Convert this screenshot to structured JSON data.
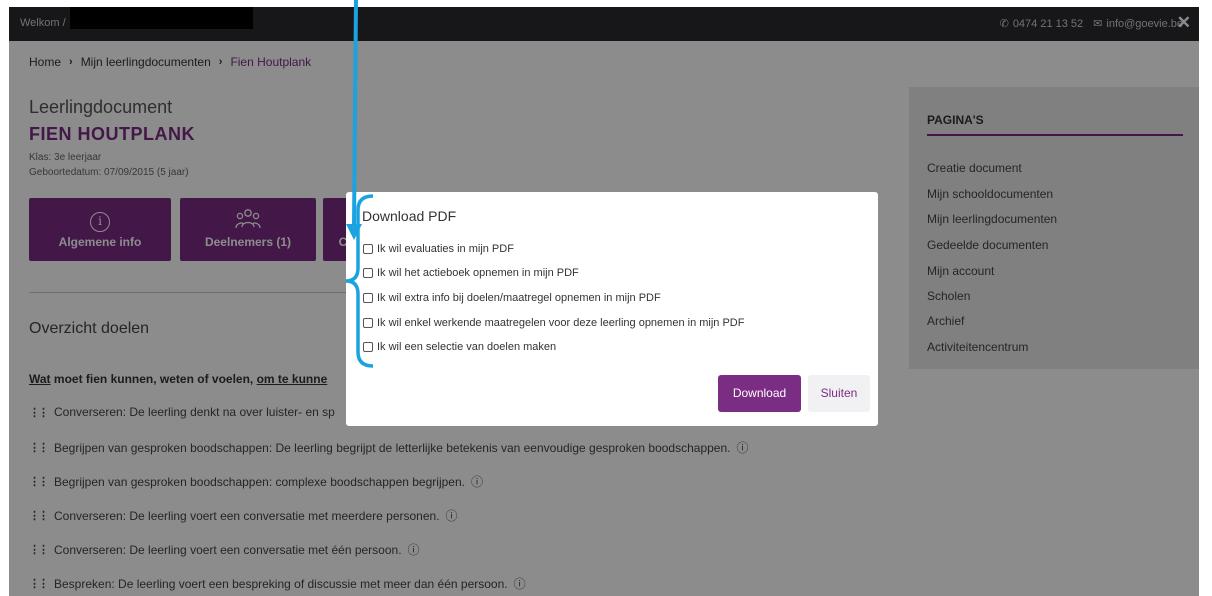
{
  "topbar": {
    "welcome": "Welkom /",
    "phone": "0474 21 13 52",
    "email": "info@goevie.be",
    "phone_icon": "phone-icon",
    "email_icon": "mail-icon",
    "close_glyph": "✕"
  },
  "breadcrumb": {
    "items": [
      "Home",
      "Mijn leerlingdocumenten",
      "Fien Houtplank"
    ],
    "separator": "›"
  },
  "header": {
    "title": "Leerlingdocument",
    "student_name": "FIEN HOUTPLANK",
    "class": "Klas: 3e leerjaar",
    "birthdate": "Geboortedatum: 07/09/2015 (5 jaar)"
  },
  "tiles": [
    {
      "label": "Algemene info",
      "icon": "info-icon"
    },
    {
      "label": "Deelnemers (1)",
      "icon": "people-icon"
    },
    {
      "label": "C",
      "icon": ""
    }
  ],
  "overview": {
    "title": "Overzicht doelen",
    "question_w1": "Wat",
    "question_mid": " moet fien kunnen, weten of voelen, ",
    "question_w2": "om te kunne"
  },
  "goals": [
    "Converseren: De leerling denkt na over luister- en sp",
    "Begrijpen van gesproken boodschappen: De leerling begrijpt de letterlijke betekenis van eenvoudige gesproken boodschappen.",
    "Begrijpen van gesproken boodschappen: complexe boodschappen begrijpen.",
    "Converseren: De leerling voert een conversatie met meerdere personen.",
    "Converseren: De leerling voert een conversatie met één persoon.",
    "Bespreken: De leerling voert een bespreking of discussie met meer dan één persoon."
  ],
  "sidebar": {
    "title": "PAGINA'S",
    "items": [
      "Creatie document",
      "Mijn schooldocumenten",
      "Mijn leerlingdocumenten",
      "Gedeelde documenten",
      "Mijn account",
      "Scholen",
      "Archief",
      "Activiteitencentrum"
    ]
  },
  "modal": {
    "title": "Download PDF",
    "options": [
      "Ik wil evaluaties in mijn PDF",
      "Ik wil het actieboek opnemen in mijn PDF",
      "Ik wil extra info bij doelen/maatregel opnemen in mijn PDF",
      "Ik wil enkel werkende maatregelen voor deze leerling opnemen in mijn PDF",
      "Ik wil een selectie van doelen maken"
    ],
    "download_label": "Download",
    "close_label": "Sluiten"
  },
  "colors": {
    "brand": "#7b2c83",
    "topbar": "#2a2b2f",
    "annotation": "#1aa3e0"
  }
}
